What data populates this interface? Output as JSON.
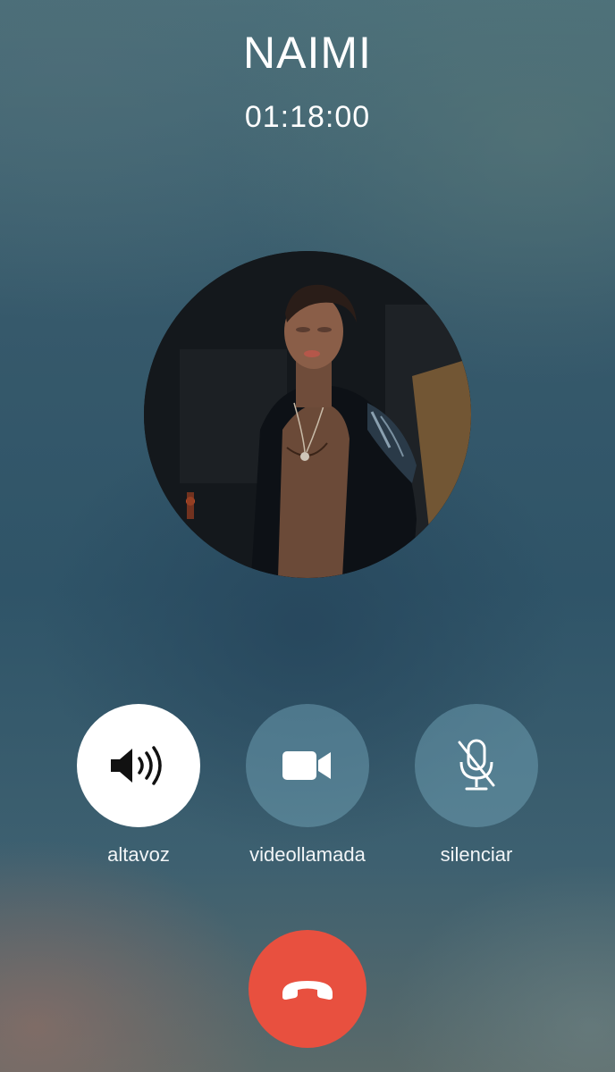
{
  "call": {
    "caller_name": "NAIMI",
    "timer": "01:18:00"
  },
  "controls": [
    {
      "label": "altavoz",
      "icon": "speaker-icon",
      "active": true
    },
    {
      "label": "videollamada",
      "icon": "video-camera-icon",
      "active": false
    },
    {
      "label": "silenciar",
      "icon": "microphone-muted-icon",
      "active": false
    }
  ],
  "hangup": {
    "icon": "hang-up-phone-icon",
    "color": "#e8503f"
  },
  "colors": {
    "control_active": "#ffffff",
    "control_inactive": "rgba(120,170,190,0.45)",
    "text": "#ffffff"
  }
}
